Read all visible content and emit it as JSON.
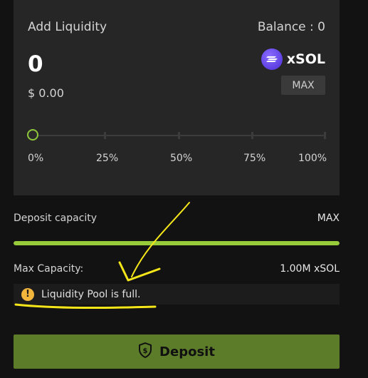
{
  "liquidity": {
    "title": "Add Liquidity",
    "balance": "Balance : 0",
    "amount": "0",
    "usd_value": "$ 0.00",
    "token": {
      "label": "xSOL",
      "icon": "xsol-token-icon"
    },
    "max_label": "MAX",
    "slider": {
      "value": 0,
      "labels": [
        "0%",
        "25%",
        "50%",
        "75%",
        "100%"
      ]
    }
  },
  "capacity": {
    "deposit_label": "Deposit capacity",
    "deposit_value": "MAX",
    "fill_fraction": 1.0,
    "max_label": "Max Capacity:",
    "max_value": "1.00M xSOL"
  },
  "alert": {
    "icon": "warning-icon",
    "text": "Liquidity Pool is full."
  },
  "deposit": {
    "label": "Deposit",
    "icon": "shield-dollar-icon"
  },
  "colors": {
    "accent_green": "#97cb3a",
    "deposit_button": "#5d7c2a",
    "warning": "#f2b63c",
    "annotation_yellow": "#f5e61a"
  }
}
